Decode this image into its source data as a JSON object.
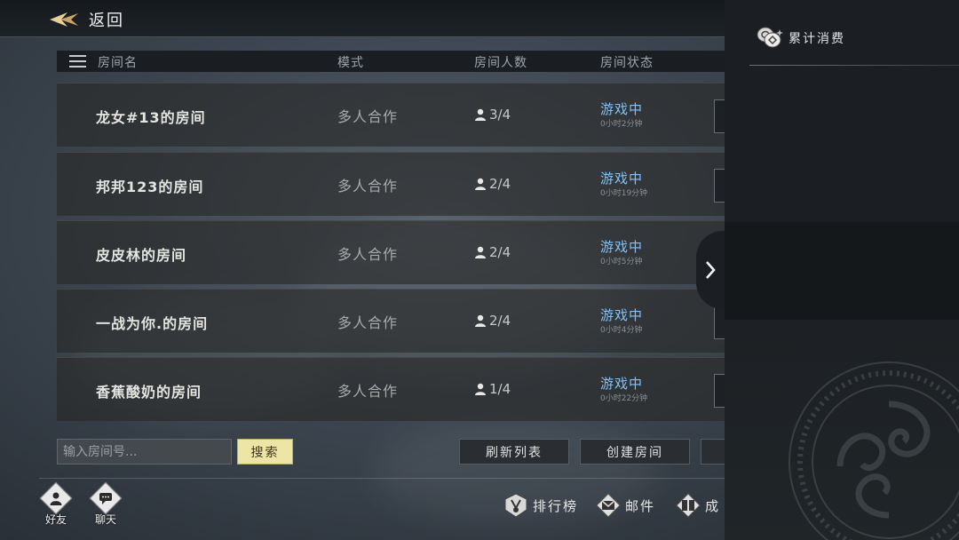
{
  "topbar": {
    "back_label": "返回"
  },
  "table": {
    "headers": {
      "name": "房间名",
      "mode": "模式",
      "players": "房间人数",
      "status": "房间状态"
    },
    "rows": [
      {
        "name": "龙女#13的房间",
        "mode": "多人合作",
        "players": "3/4",
        "status": "游戏中",
        "time": "0小时2分钟"
      },
      {
        "name": "邦邦123的房间",
        "mode": "多人合作",
        "players": "2/4",
        "status": "游戏中",
        "time": "0小时19分钟"
      },
      {
        "name": "皮皮林的房间",
        "mode": "多人合作",
        "players": "2/4",
        "status": "游戏中",
        "time": "0小时5分钟"
      },
      {
        "name": "一战为你.的房间",
        "mode": "多人合作",
        "players": "2/4",
        "status": "游戏中",
        "time": "0小时4分钟"
      },
      {
        "name": "香蕉酸奶的房间",
        "mode": "多人合作",
        "players": "1/4",
        "status": "游戏中",
        "time": "0小时22分钟"
      }
    ]
  },
  "controls": {
    "room_input_placeholder": "输入房间号...",
    "search_label": "搜索",
    "refresh_label": "刷新列表",
    "create_label": "创建房间"
  },
  "bottom_nav": {
    "friends_label": "好友",
    "chat_label": "聊天",
    "ranking_label": "排行榜",
    "mail_label": "邮件",
    "achievement_label": "成"
  },
  "right_panel": {
    "title": "累计消费"
  },
  "colors": {
    "status_blue": "#7ec3ff",
    "search_yellow": "#ece5a6"
  }
}
